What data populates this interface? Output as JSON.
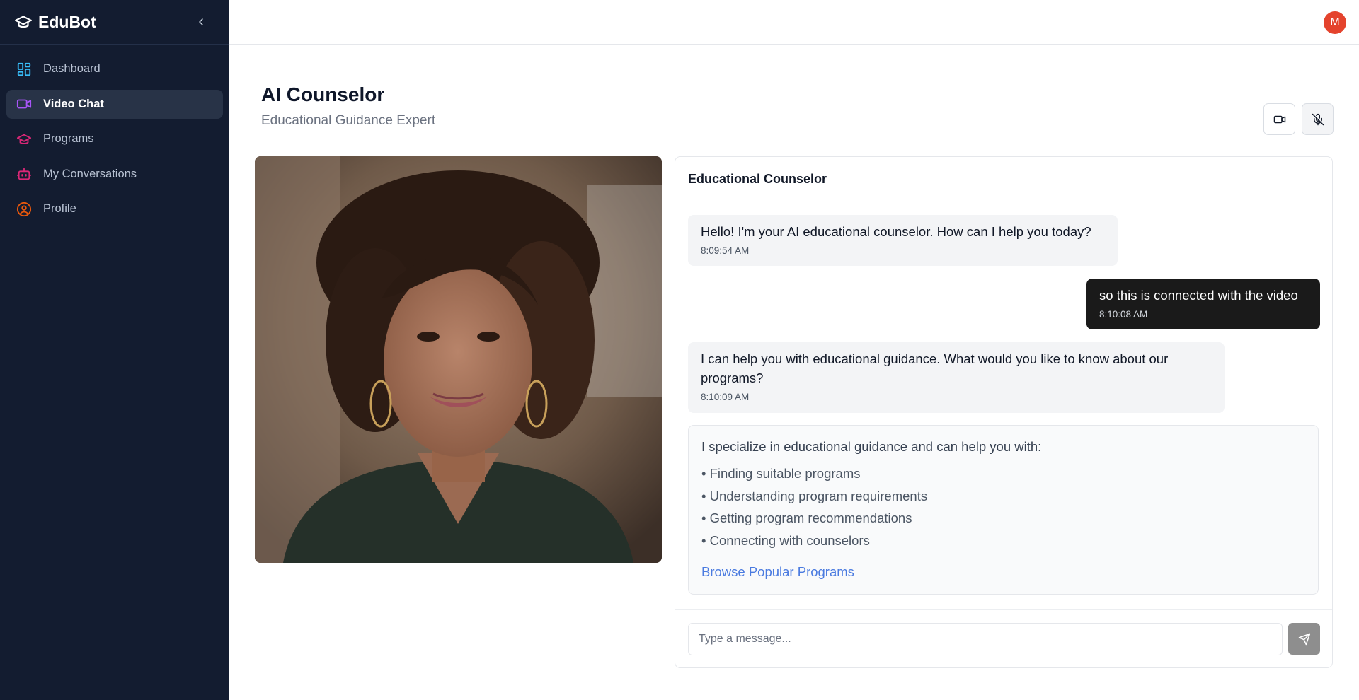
{
  "app": {
    "name": "EduBot"
  },
  "sidebar": {
    "items": [
      {
        "label": "Dashboard",
        "icon": "dashboard-icon",
        "color": "#38bdf8"
      },
      {
        "label": "Video Chat",
        "icon": "video-icon",
        "color": "#a855f7",
        "active": true
      },
      {
        "label": "Programs",
        "icon": "graduation-cap-icon",
        "color": "#db2777"
      },
      {
        "label": "My Conversations",
        "icon": "bot-icon",
        "color": "#db2777"
      },
      {
        "label": "Profile",
        "icon": "user-circle-icon",
        "color": "#ea580c"
      }
    ]
  },
  "user": {
    "initial": "M"
  },
  "header": {
    "title": "AI Counselor",
    "subtitle": "Educational Guidance Expert"
  },
  "chat": {
    "title": "Educational Counselor",
    "messages": [
      {
        "role": "bot",
        "text": "Hello! I'm your AI educational counselor. How can I help you today?",
        "time": "8:09:54 AM"
      },
      {
        "role": "user",
        "text": "so this is connected with the video",
        "time": "8:10:08 AM"
      },
      {
        "role": "bot",
        "text": "I can help you with educational guidance. What would you like to know about our programs?",
        "time": "8:10:09 AM"
      }
    ],
    "info": {
      "intro": "I specialize in educational guidance and can help you with:",
      "items": [
        "• Finding suitable programs",
        "• Understanding program requirements",
        "• Getting program recommendations",
        "• Connecting with counselors"
      ],
      "link": "Browse Popular Programs"
    },
    "input": {
      "placeholder": "Type a message...",
      "value": ""
    }
  },
  "colors": {
    "sidebar_bg": "#131c30",
    "avatar": "#e4432d",
    "link": "#4b7be0",
    "user_bubble": "#1a1a1a"
  }
}
